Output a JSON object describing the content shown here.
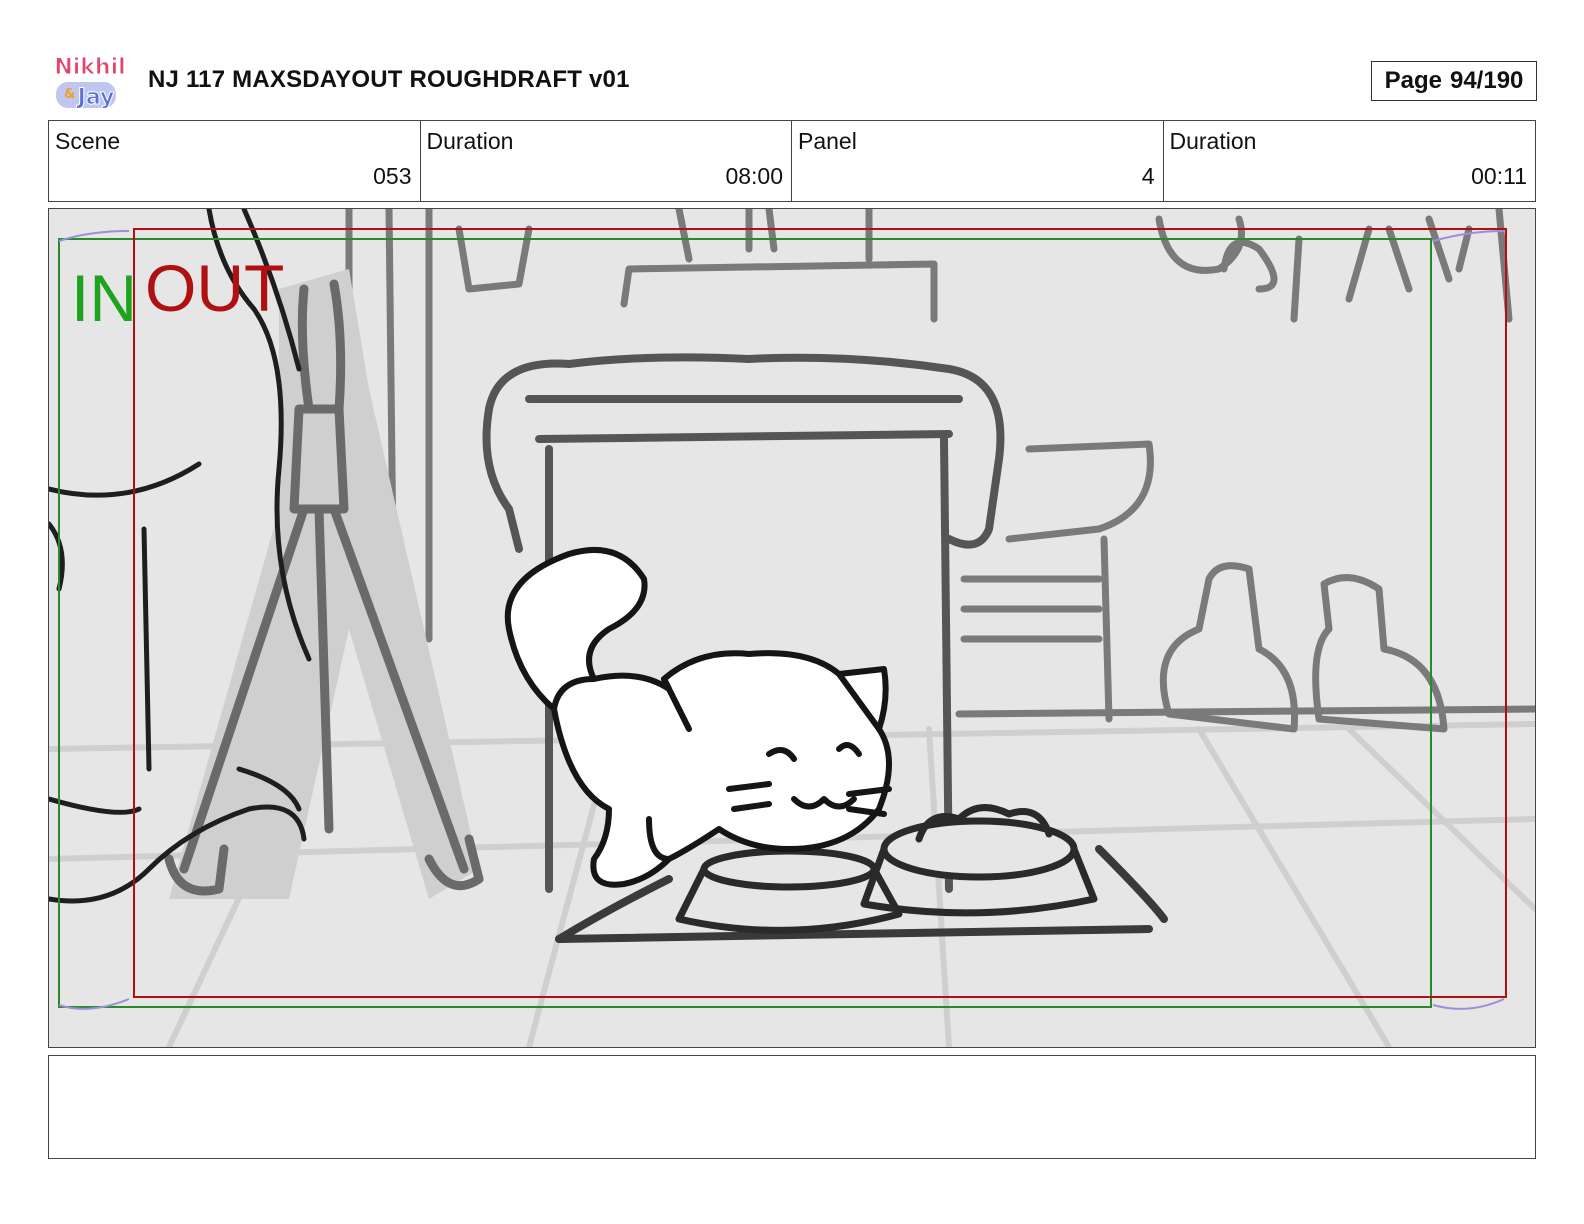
{
  "header": {
    "logo_text": "Nikhil & Jay",
    "title": "NJ 117 MAXSDAYOUT ROUGHDRAFT v01",
    "page_label": "Page",
    "page_value": "94/190"
  },
  "info": {
    "scene_label": "Scene",
    "scene_value": "053",
    "scene_duration_label": "Duration",
    "scene_duration_value": "08:00",
    "panel_label": "Panel",
    "panel_value": "4",
    "panel_duration_label": "Duration",
    "panel_duration_value": "00:11"
  },
  "frame_markers": {
    "in_label": "IN",
    "out_label": "OUT",
    "in_color": "#1fa31f",
    "out_color": "#b01010"
  },
  "notes": {
    "text": ""
  }
}
